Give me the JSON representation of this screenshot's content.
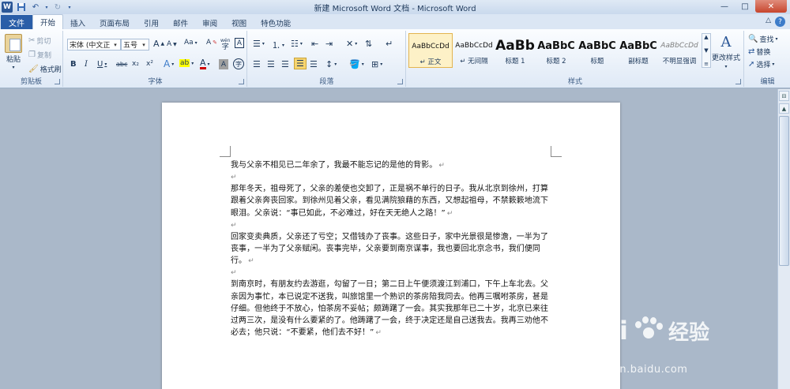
{
  "window": {
    "title": "新建 Microsoft Word 文档 - Microsoft Word",
    "app_icon": "W"
  },
  "tabs": {
    "file": "文件",
    "items": [
      "开始",
      "插入",
      "页面布局",
      "引用",
      "邮件",
      "审阅",
      "视图",
      "特色功能"
    ],
    "active": "开始"
  },
  "ribbon": {
    "clipboard": {
      "label": "剪贴板",
      "paste": "粘贴",
      "cut": "剪切",
      "copy": "复制",
      "format_painter": "格式刷"
    },
    "font": {
      "label": "字体",
      "font_name": "宋体 (中文正",
      "font_size": "五号",
      "bold": "B",
      "italic": "I",
      "underline": "U",
      "strike": "abc",
      "subscript": "x₂",
      "superscript": "x²",
      "grow": "A",
      "shrink": "A",
      "change_case": "Aa",
      "clear": "A",
      "pinyin": "wén",
      "border_char": "A",
      "text_effect": "A",
      "highlight": "ab",
      "font_color": "A",
      "shading": "A",
      "enclose": "字"
    },
    "paragraph": {
      "label": "段落"
    },
    "styles": {
      "label": "样式",
      "items": [
        {
          "sample": "AaBbCcDd",
          "name": "↵ 正文"
        },
        {
          "sample": "AaBbCcDd",
          "name": "↵ 无间隔"
        },
        {
          "sample": "AaBb",
          "name": "标题 1"
        },
        {
          "sample": "AaBbC",
          "name": "标题 2"
        },
        {
          "sample": "AaBbC",
          "name": "标题"
        },
        {
          "sample": "AaBbC",
          "name": "副标题"
        },
        {
          "sample": "AaBbCcDd",
          "name": "不明显强调"
        }
      ],
      "change_styles": "更改样式"
    },
    "editing": {
      "label": "编辑",
      "find": "查找",
      "replace": "替换",
      "select": "选择"
    }
  },
  "document": {
    "paragraphs": [
      "我与父亲不相见已二年余了，我最不能忘记的是他的背影。",
      "那年冬天，祖母死了，父亲的差使也交卸了，正是祸不单行的日子。我从北京到徐州，打算跟着父亲奔丧回家。到徐州见着父亲，看见满院狼藉的东西，又想起祖母，不禁簌簌地流下眼泪。父亲说：“事已如此，不必难过，好在天无绝人之路！”",
      "回家变卖典质，父亲还了亏空；又借钱办了丧事。这些日子，家中光景很是惨澹，一半为了丧事，一半为了父亲赋闲。丧事完毕，父亲要到南京谋事，我也要回北京念书，我们便同行。",
      "到南京时，有朋友约去游逛，勾留了一日；第二日上午便须渡江到浦口，下午上车北去。父亲因为事忙，本已说定不送我，叫旅馆里一个熟识的茶房陪我同去。他再三嘱咐茶房，甚是仔细。但他终于不放心，怕茶房不妥帖；颇踌躇了一会。其实我那年已二十岁，北京已来往过两三次，是没有什么要紧的了。他踌躇了一会，终于决定还是自己送我去。我再三劝他不必去；他只说：“不要紧，他们去不好！”"
    ],
    "para_mark": "↵"
  },
  "watermark": {
    "brand_left": "Bai",
    "brand_right": "经验",
    "url": "jingyan.baidu.com"
  },
  "colors": {
    "file_tab": "#2a5ea8",
    "ribbon_bg": "#dfe9f6",
    "doc_bg": "#aab8c9",
    "selected_style": "#fdf1c7"
  }
}
